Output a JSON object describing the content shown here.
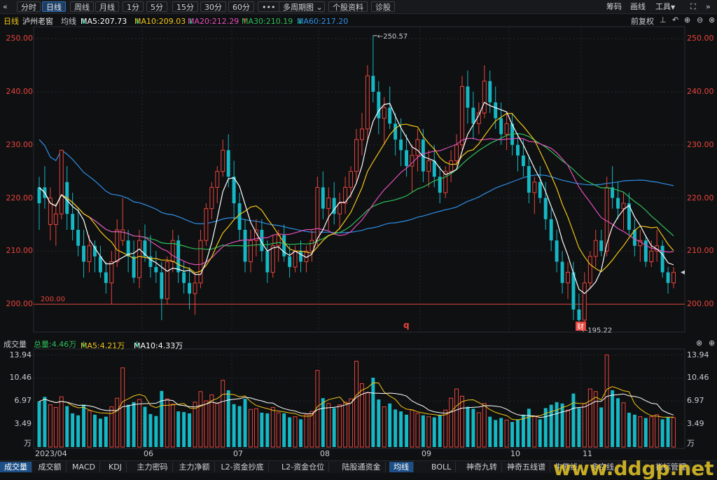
{
  "toolbar": {
    "back_icon": "double-chevron-left-icon",
    "periods": [
      "分时",
      "日线",
      "周线",
      "月线",
      "1分",
      "5分",
      "15分",
      "30分",
      "60分"
    ],
    "active_period": "日线",
    "more_label": "•••",
    "multi_period_label": "多周期图",
    "stock_info_label": "个股资料",
    "diagnose_label": "诊股",
    "chip_label": "筹码",
    "draw_label": "画线",
    "tools_label": "工具"
  },
  "header": {
    "period": "日线",
    "stock_name": "泸州老窖",
    "ma_label": "均线",
    "ma5": "MA5:207.73",
    "ma10": "MA10:209.03",
    "ma20": "MA20:212.29",
    "ma30": "MA30:210.19",
    "ma60": "MA60:217.20",
    "adjust_label": "前复权"
  },
  "price_axis": {
    "labels": [
      "250.00",
      "240.00",
      "230.00",
      "220.00",
      "210.00",
      "200.00"
    ],
    "line_label": "200.00",
    "high_label": "250.57",
    "low_label": "195.22",
    "marker_q": "q",
    "marker_cai": "财"
  },
  "volume_header": {
    "title": "成交量",
    "total": "总量:4.46万",
    "ma5": "MA5:4.21万",
    "ma10": "MA10:4.33万"
  },
  "volume_axis": {
    "labels": [
      "13.94",
      "10.46",
      "6.97",
      "3.49"
    ],
    "unit": "万"
  },
  "x_axis": {
    "labels": [
      "2023/04",
      "06",
      "07",
      "08",
      "09",
      "10",
      "11"
    ]
  },
  "bottom_tabs": [
    "成交量",
    "成交额",
    "MACD",
    "KDJ",
    "主力密码",
    "主力净额",
    "L2-资金抄底",
    "L2-资金仓位",
    "陆股通资金"
  ],
  "bottom_right_tabs": [
    "均线",
    "BOLL",
    "神奇九转",
    "神奇五线谱",
    "牛熊线",
    "多空线",
    "指标管理"
  ],
  "watermark": "www.ddgp.net",
  "colors": {
    "up": "#e8453c",
    "down": "#15b8c4",
    "ma5": "#ffffff",
    "ma10": "#f2c618",
    "ma20": "#e24fb8",
    "ma30": "#2fbf5a",
    "ma60": "#2f8fe6"
  },
  "chart_data": {
    "type": "candlestick",
    "price_ylim": [
      195,
      252
    ],
    "volume_ylim": [
      0,
      14
    ],
    "x_labels": [
      "2023/04",
      "06",
      "07",
      "08",
      "09",
      "10",
      "11"
    ],
    "ma_series_names": [
      "MA5",
      "MA10",
      "MA20",
      "MA30",
      "MA60"
    ],
    "candles": [
      [
        219,
        224,
        214,
        222,
        6.9,
        0
      ],
      [
        222,
        226,
        218,
        220,
        7.6,
        0
      ],
      [
        220,
        222,
        212,
        215,
        6.4,
        1
      ],
      [
        215,
        219,
        211,
        217,
        6.0,
        1
      ],
      [
        217,
        224,
        216,
        229,
        7.6,
        1
      ],
      [
        223,
        226,
        214,
        217,
        6.2,
        0
      ],
      [
        217,
        221,
        212,
        214,
        5.1,
        0
      ],
      [
        214,
        218,
        209,
        211,
        4.8,
        0
      ],
      [
        211,
        214,
        205,
        208,
        6.4,
        0
      ],
      [
        208,
        213,
        206,
        211,
        5.5,
        1
      ],
      [
        211,
        212,
        206,
        209,
        4.9,
        0
      ],
      [
        209,
        211,
        205,
        206,
        4.3,
        0
      ],
      [
        206,
        208,
        202,
        204,
        4.6,
        0
      ],
      [
        204,
        210,
        200,
        208,
        6.1,
        1
      ],
      [
        208,
        216,
        207,
        214,
        7.4,
        1
      ],
      [
        214,
        220,
        211,
        212,
        12.0,
        1
      ],
      [
        212,
        214,
        206,
        209,
        6.4,
        0
      ],
      [
        209,
        212,
        204,
        205,
        6.8,
        0
      ],
      [
        205,
        214,
        203,
        212,
        7.2,
        1
      ],
      [
        212,
        215,
        208,
        209,
        6.1,
        0
      ],
      [
        209,
        213,
        205,
        207,
        5.0,
        0
      ],
      [
        207,
        210,
        204,
        206,
        4.7,
        0
      ],
      [
        206,
        208,
        197,
        201,
        8.5,
        0
      ],
      [
        201,
        209,
        200,
        208,
        7.3,
        1
      ],
      [
        208,
        214,
        206,
        212,
        6.5,
        1
      ],
      [
        212,
        213,
        204,
        206,
        5.4,
        0
      ],
      [
        206,
        208,
        202,
        204,
        5.3,
        0
      ],
      [
        204,
        207,
        199,
        202,
        5.1,
        0
      ],
      [
        202,
        206,
        198,
        204,
        6.8,
        1
      ],
      [
        204,
        214,
        203,
        212,
        8.4,
        1
      ],
      [
        212,
        219,
        211,
        218,
        7.0,
        1
      ],
      [
        218,
        223,
        216,
        222,
        7.9,
        1
      ],
      [
        222,
        226,
        219,
        225,
        6.6,
        1
      ],
      [
        225,
        231,
        224,
        229,
        10.1,
        1
      ],
      [
        229,
        232,
        222,
        224,
        8.6,
        0
      ],
      [
        224,
        227,
        216,
        219,
        6.5,
        0
      ],
      [
        219,
        221,
        212,
        214,
        6.2,
        0
      ],
      [
        214,
        216,
        206,
        208,
        7.3,
        0
      ],
      [
        208,
        214,
        206,
        212,
        5.7,
        1
      ],
      [
        212,
        216,
        209,
        214,
        5.8,
        1
      ],
      [
        214,
        216,
        208,
        210,
        5.2,
        0
      ],
      [
        210,
        212,
        204,
        206,
        5.1,
        0
      ],
      [
        206,
        213,
        205,
        211,
        6.0,
        1
      ],
      [
        211,
        214,
        208,
        213,
        5.2,
        1
      ],
      [
        213,
        215,
        208,
        209,
        5.1,
        0
      ],
      [
        209,
        211,
        205,
        207,
        4.5,
        0
      ],
      [
        207,
        211,
        206,
        210,
        4.6,
        1
      ],
      [
        210,
        212,
        206,
        208,
        4.2,
        0
      ],
      [
        208,
        211,
        206,
        210,
        4.9,
        1
      ],
      [
        210,
        214,
        208,
        212,
        5.4,
        1
      ],
      [
        212,
        224,
        211,
        222,
        11.6,
        1
      ],
      [
        222,
        225,
        216,
        218,
        7.4,
        0
      ],
      [
        218,
        222,
        214,
        220,
        6.6,
        1
      ],
      [
        220,
        223,
        215,
        217,
        5.9,
        0
      ],
      [
        217,
        221,
        214,
        219,
        6.4,
        1
      ],
      [
        219,
        224,
        217,
        222,
        6.8,
        1
      ],
      [
        222,
        226,
        220,
        225,
        7.3,
        1
      ],
      [
        225,
        233,
        223,
        231,
        13.0,
        1
      ],
      [
        231,
        236,
        228,
        233,
        9.6,
        1
      ],
      [
        233,
        245,
        231,
        243,
        8.2,
        1
      ],
      [
        243,
        250.57,
        238,
        240,
        10.5,
        0
      ],
      [
        240,
        242,
        232,
        235,
        7.2,
        0
      ],
      [
        235,
        239,
        230,
        237,
        6.1,
        1
      ],
      [
        237,
        241,
        233,
        234,
        6.6,
        0
      ],
      [
        234,
        236,
        228,
        231,
        5.7,
        0
      ],
      [
        231,
        235,
        226,
        229,
        5.4,
        0
      ],
      [
        229,
        232,
        224,
        226,
        4.9,
        0
      ],
      [
        226,
        230,
        221,
        228,
        5.6,
        1
      ],
      [
        228,
        233,
        225,
        231,
        5.1,
        1
      ],
      [
        231,
        233,
        223,
        225,
        4.8,
        0
      ],
      [
        225,
        229,
        222,
        227,
        4.6,
        1
      ],
      [
        227,
        230,
        222,
        224,
        4.5,
        0
      ],
      [
        224,
        226,
        219,
        221,
        4.9,
        0
      ],
      [
        221,
        226,
        220,
        225,
        5.6,
        1
      ],
      [
        225,
        229,
        223,
        227,
        7.4,
        1
      ],
      [
        227,
        232,
        226,
        230,
        8.8,
        1
      ],
      [
        230,
        243,
        229,
        241,
        7.7,
        1
      ],
      [
        241,
        244,
        234,
        237,
        6.1,
        0
      ],
      [
        237,
        240,
        231,
        234,
        5.8,
        0
      ],
      [
        234,
        238,
        232,
        236,
        5.2,
        1
      ],
      [
        236,
        245,
        235,
        242,
        6.6,
        1
      ],
      [
        242,
        244,
        236,
        238,
        4.6,
        0
      ],
      [
        238,
        241,
        233,
        235,
        4.1,
        0
      ],
      [
        235,
        238,
        230,
        232,
        4.4,
        0
      ],
      [
        232,
        236,
        229,
        234,
        4.1,
        1
      ],
      [
        234,
        236,
        228,
        230,
        3.8,
        0
      ],
      [
        230,
        232,
        225,
        228,
        4.2,
        0
      ],
      [
        228,
        231,
        224,
        226,
        4.9,
        0
      ],
      [
        226,
        228,
        219,
        221,
        5.8,
        0
      ],
      [
        221,
        224,
        217,
        223,
        4.6,
        1
      ],
      [
        223,
        226,
        219,
        220,
        4.2,
        0
      ],
      [
        220,
        223,
        214,
        216,
        5.9,
        0
      ],
      [
        216,
        218,
        210,
        212,
        6.4,
        0
      ],
      [
        212,
        214,
        206,
        208,
        6.8,
        0
      ],
      [
        208,
        210,
        202,
        204,
        6.6,
        0
      ],
      [
        204,
        208,
        201,
        206,
        5.6,
        1
      ],
      [
        206,
        208,
        197,
        199,
        8.1,
        0
      ],
      [
        199,
        202,
        195.22,
        197,
        5.9,
        0
      ],
      [
        197,
        206,
        196,
        204,
        6.6,
        1
      ],
      [
        204,
        210,
        203,
        209,
        8.8,
        1
      ],
      [
        209,
        214,
        207,
        212,
        8.4,
        1
      ],
      [
        212,
        214,
        209,
        210,
        6.0,
        0
      ],
      [
        210,
        224,
        209,
        222,
        13.94,
        1
      ],
      [
        222,
        226,
        218,
        220,
        8.6,
        0
      ],
      [
        220,
        223,
        216,
        218,
        7.4,
        0
      ],
      [
        218,
        221,
        214,
        219,
        6.7,
        1
      ],
      [
        219,
        221,
        213,
        214,
        5.2,
        0
      ],
      [
        214,
        216,
        209,
        211,
        4.9,
        0
      ],
      [
        211,
        214,
        208,
        212,
        4.6,
        1
      ],
      [
        212,
        213,
        207,
        208,
        4.4,
        0
      ],
      [
        208,
        212,
        207,
        210,
        4.6,
        1
      ],
      [
        210,
        214,
        208,
        211,
        4.9,
        1
      ],
      [
        211,
        212,
        205,
        206,
        4.2,
        0
      ],
      [
        206,
        207,
        202,
        204,
        4.5,
        0
      ],
      [
        204,
        207,
        203,
        206,
        4.46,
        1
      ]
    ]
  }
}
